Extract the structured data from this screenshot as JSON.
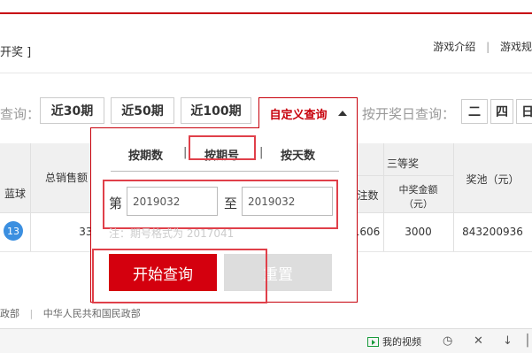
{
  "header": {
    "bracket_text": "开奖 ]",
    "links": [
      "游戏介绍",
      "游戏规"
    ]
  },
  "query": {
    "label": "查询：",
    "recent_buttons": [
      "近30期",
      "近50期",
      "近100期"
    ],
    "custom_label": "自定义查询",
    "date_label": "按开奖日查询：",
    "weekdays": [
      "二",
      "四",
      "日"
    ]
  },
  "table": {
    "headers": {
      "blue": "蓝球",
      "total_sales": "总销售额",
      "third_prize": "三等奖",
      "count": "注数",
      "prize_amount_line1": "中奖金额",
      "prize_amount_line2": "（元）",
      "pool": "奖池（元）"
    },
    "row": {
      "blue_ball": "13",
      "total_sales": "338,904",
      "count": "1606",
      "prize_amount": "3000",
      "pool": "843200936"
    }
  },
  "panel": {
    "tabs": [
      "按期数",
      "按期号",
      "按天数"
    ],
    "separator": "|",
    "from_label": "第",
    "to_label": "至",
    "from_value": "2019032",
    "to_value": "2019032",
    "hint": "注：期号格式为 2017041",
    "start_button": "开始查询",
    "reset_button": "重置"
  },
  "footer": {
    "links": [
      "政部",
      "中华人民共和国民政部"
    ]
  },
  "bottom_bar": {
    "my_video": "我的视频"
  },
  "colors": {
    "brand_red": "#c7000b",
    "button_red": "#d4000e",
    "highlight": "#e0404a",
    "ball_blue": "#3b8fe0"
  }
}
